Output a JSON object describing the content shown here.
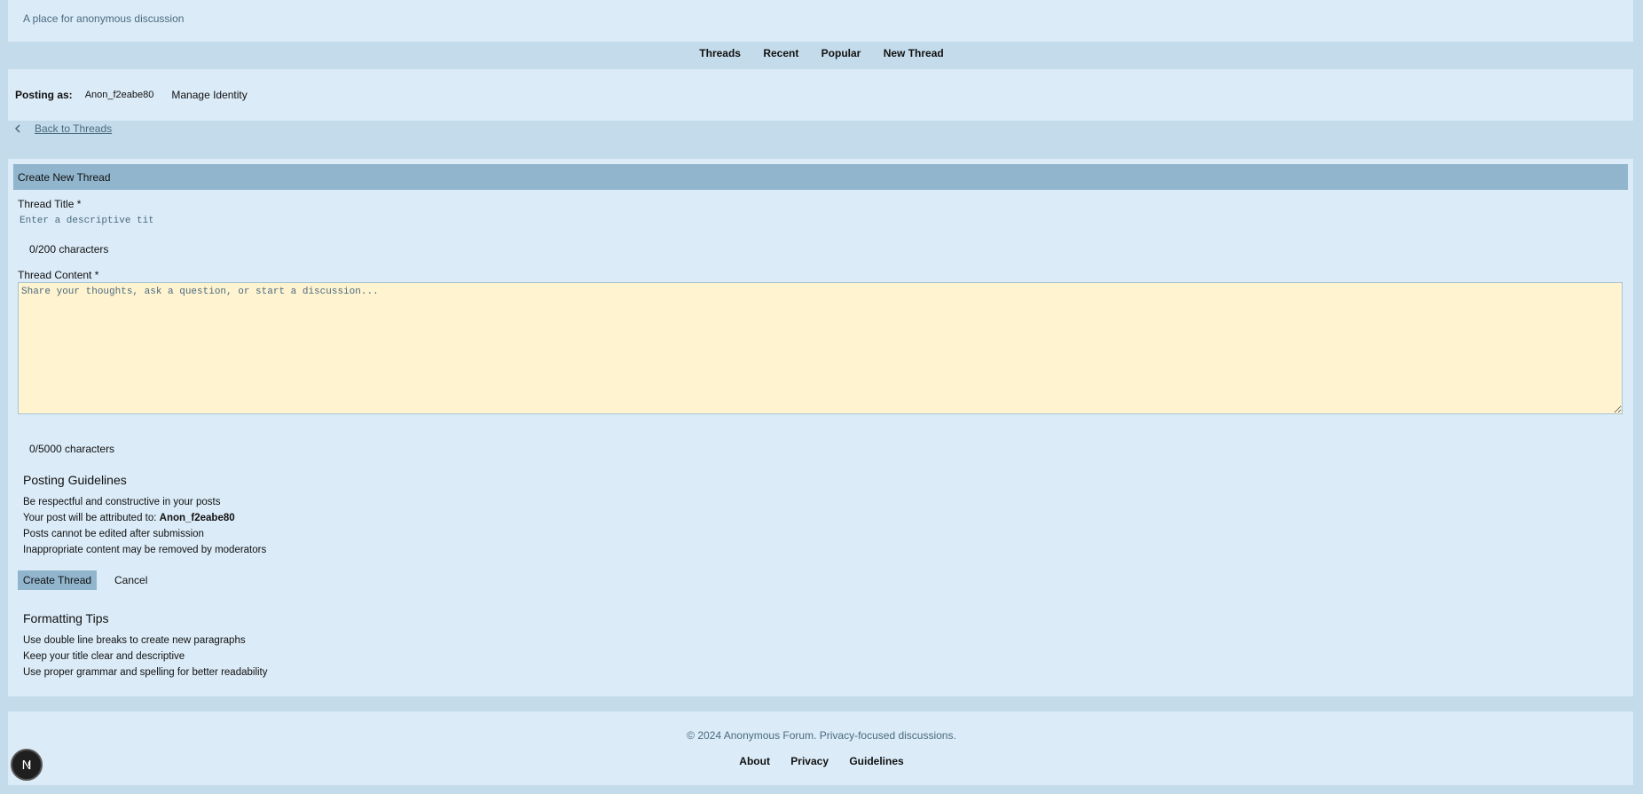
{
  "header": {
    "tagline": "A place for anonymous discussion"
  },
  "nav": {
    "items": [
      "Threads",
      "Recent",
      "Popular",
      "New Thread"
    ]
  },
  "identity": {
    "label": "Posting as:",
    "username": "Anon_f2eabe80",
    "manage_label": "Manage Identity"
  },
  "back_link": "Back to Threads",
  "form": {
    "heading": "Create New Thread",
    "title_label": "Thread Title *",
    "title_placeholder": "Enter a descriptive title...",
    "title_value": "",
    "title_counter": "0/200 characters",
    "content_label": "Thread Content *",
    "content_placeholder": "Share your thoughts, ask a question, or start a discussion...",
    "content_value": "",
    "content_counter": "0/5000 characters",
    "submit_label": "Create Thread",
    "cancel_label": "Cancel"
  },
  "guidelines": {
    "heading": "Posting Guidelines",
    "line1": "Be respectful and constructive in your posts",
    "line2_prefix": "Your post will be attributed to: ",
    "line2_user": "Anon_f2eabe80",
    "line3": "Posts cannot be edited after submission",
    "line4": "Inappropriate content may be removed by moderators"
  },
  "tips": {
    "heading": "Formatting Tips",
    "items": [
      "Use double line breaks to create new paragraphs",
      "Keep your title clear and descriptive",
      "Use proper grammar and spelling for better readability"
    ]
  },
  "footer": {
    "copyright": "© 2024 Anonymous Forum. Privacy-focused discussions.",
    "links": [
      "About",
      "Privacy",
      "Guidelines"
    ]
  },
  "dev_badge": {
    "letter": "N",
    "icon": "nextjs-logo-icon"
  },
  "colors": {
    "background": "#c3dbea",
    "panel": "#dbebf7",
    "accent": "#90b5cd",
    "textarea_bg": "#fff3d0",
    "muted_text": "#4a6b80"
  }
}
